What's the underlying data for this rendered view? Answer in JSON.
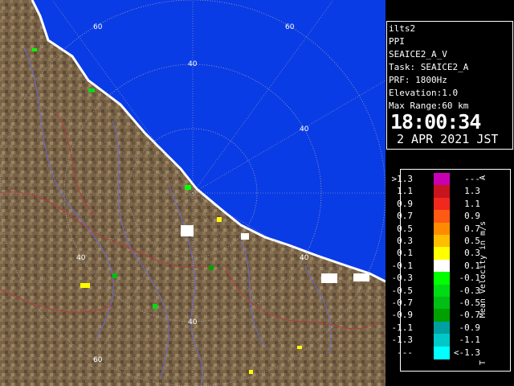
{
  "info": {
    "site": "ilts2",
    "mode": "PPI",
    "product": "SEAICE2_A_V",
    "task": "Task: SEAICE2_A",
    "prf": "PRF: 1800Hz",
    "elevation": "Elevation:1.0",
    "max_range": "Max Range:60 km",
    "time": "18:00:34",
    "date": "2 APR 2021 JST"
  },
  "map": {
    "range_labels": [
      "60",
      "60",
      "40",
      "40",
      "40",
      "40",
      "40",
      "60"
    ],
    "sea_color": "#0a3ce6",
    "land_color": "#7a6448"
  },
  "legend": {
    "title": "Mean Velocity in m/s",
    "corner_top": "A",
    "corner_bottom": "T",
    "rows": [
      {
        "left": ">1.3",
        "right": "---",
        "color": "#c800b4"
      },
      {
        "left": "1.1",
        "right": "1.3",
        "color": "#c8141e"
      },
      {
        "left": "0.9",
        "right": "1.1",
        "color": "#f0281e"
      },
      {
        "left": "0.7",
        "right": "0.9",
        "color": "#ff5a14"
      },
      {
        "left": "0.5",
        "right": "0.7",
        "color": "#ff8c00"
      },
      {
        "left": "0.3",
        "right": "0.5",
        "color": "#ffbe00"
      },
      {
        "left": "0.1",
        "right": "0.3",
        "color": "#ffff00"
      },
      {
        "left": "-0.1",
        "right": "0.1",
        "color": "#ffffff"
      },
      {
        "left": "-0.3",
        "right": "-0.1",
        "color": "#00ff00"
      },
      {
        "left": "-0.5",
        "right": "-0.3",
        "color": "#00dc14"
      },
      {
        "left": "-0.7",
        "right": "-0.5",
        "color": "#00be14"
      },
      {
        "left": "-0.9",
        "right": "-0.7",
        "color": "#00a000"
      },
      {
        "left": "-1.1",
        "right": "-0.9",
        "color": "#00a0a0"
      },
      {
        "left": "-1.3",
        "right": "-1.1",
        "color": "#00c8c8"
      },
      {
        "left": "---",
        "right": "<-1.3",
        "color": "#00ffff"
      }
    ]
  }
}
